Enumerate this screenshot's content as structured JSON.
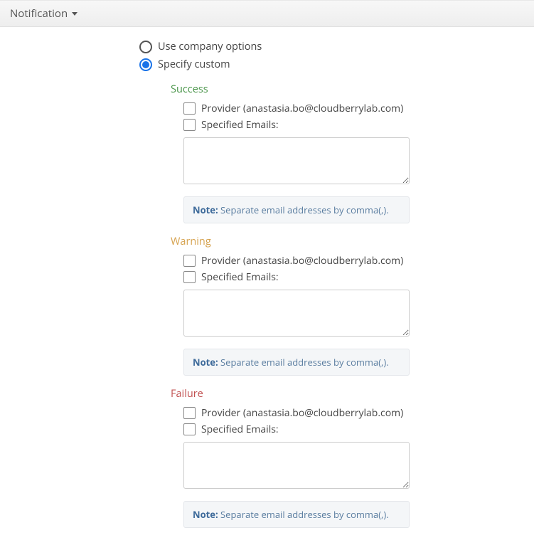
{
  "header": {
    "title": "Notification"
  },
  "options": {
    "use_company_label": "Use company options",
    "specify_custom_label": "Specify custom"
  },
  "sections": {
    "success": {
      "title": "Success",
      "provider_label": "Provider (anastasia.bo@cloudberrylab.com)",
      "specified_emails_label": "Specified Emails:",
      "emails_value": "",
      "note_label": "Note:",
      "note_text": "Separate email addresses by comma(,)."
    },
    "warning": {
      "title": "Warning",
      "provider_label": "Provider (anastasia.bo@cloudberrylab.com)",
      "specified_emails_label": "Specified Emails:",
      "emails_value": "",
      "note_label": "Note:",
      "note_text": "Separate email addresses by comma(,)."
    },
    "failure": {
      "title": "Failure",
      "provider_label": "Provider (anastasia.bo@cloudberrylab.com)",
      "specified_emails_label": "Specified Emails:",
      "emails_value": "",
      "note_label": "Note:",
      "note_text": "Separate email addresses by comma(,)."
    }
  }
}
